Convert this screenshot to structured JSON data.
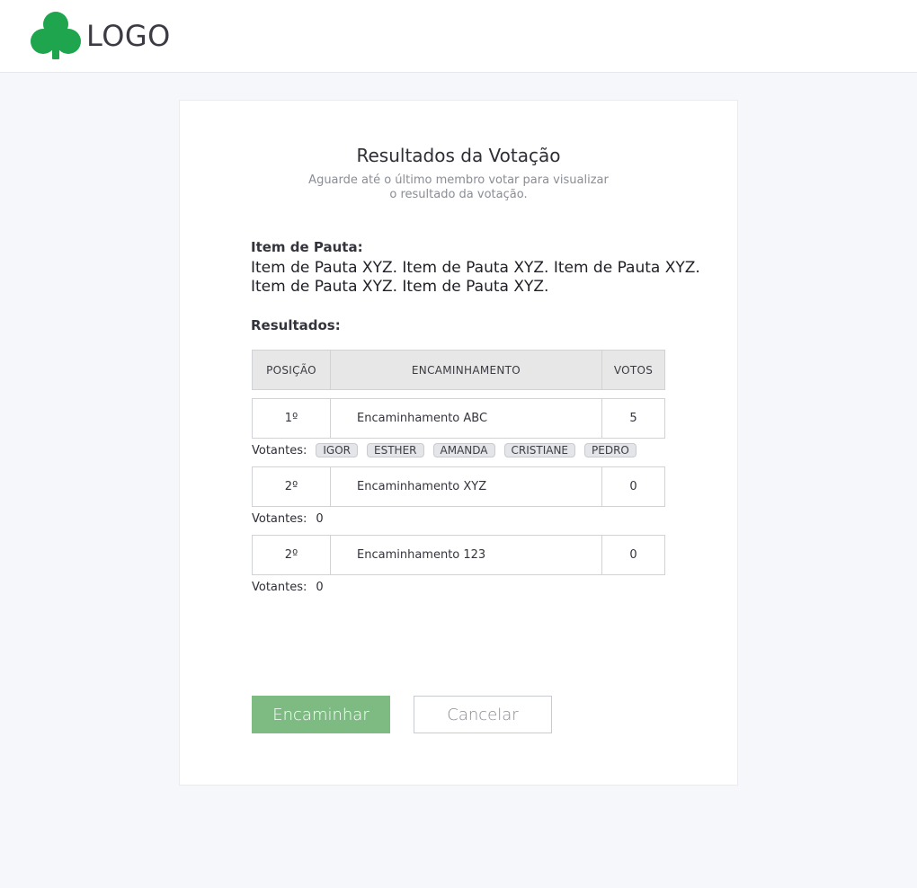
{
  "header": {
    "logo_text": "LOGO",
    "logo_color": "#1fa54e"
  },
  "card": {
    "title": "Resultados da Votação",
    "subtitle_line1": "Aguarde até o último membro votar para visualizar",
    "subtitle_line2": "o resultado da votação.",
    "item_label": "Item de Pauta:",
    "item_text": "Item de Pauta XYZ. Item de Pauta XYZ. Item de Pauta XYZ. Item de Pauta XYZ. Item de Pauta XYZ.",
    "results_label": "Resultados:"
  },
  "table": {
    "headers": [
      "POSIÇÃO",
      "ENCAMINHAMENTO",
      "VOTOS"
    ],
    "rows": [
      {
        "position": "1º",
        "referral": "Encaminhamento ABC",
        "votes": "5",
        "voters_label": "Votantes:",
        "voters": [
          "IGOR",
          "ESTHER",
          "AMANDA",
          "CRISTIANE",
          "PEDRO"
        ],
        "voters_count": ""
      },
      {
        "position": "2º",
        "referral": "Encaminhamento XYZ",
        "votes": "0",
        "voters_label": "Votantes:",
        "voters": [],
        "voters_count": "0"
      },
      {
        "position": "2º",
        "referral": "Encaminhamento 123",
        "votes": "0",
        "voters_label": "Votantes:",
        "voters": [],
        "voters_count": "0"
      }
    ]
  },
  "actions": {
    "primary_label": "Encaminhar",
    "secondary_label": "Cancelar",
    "primary_color": "#7dbb83"
  }
}
